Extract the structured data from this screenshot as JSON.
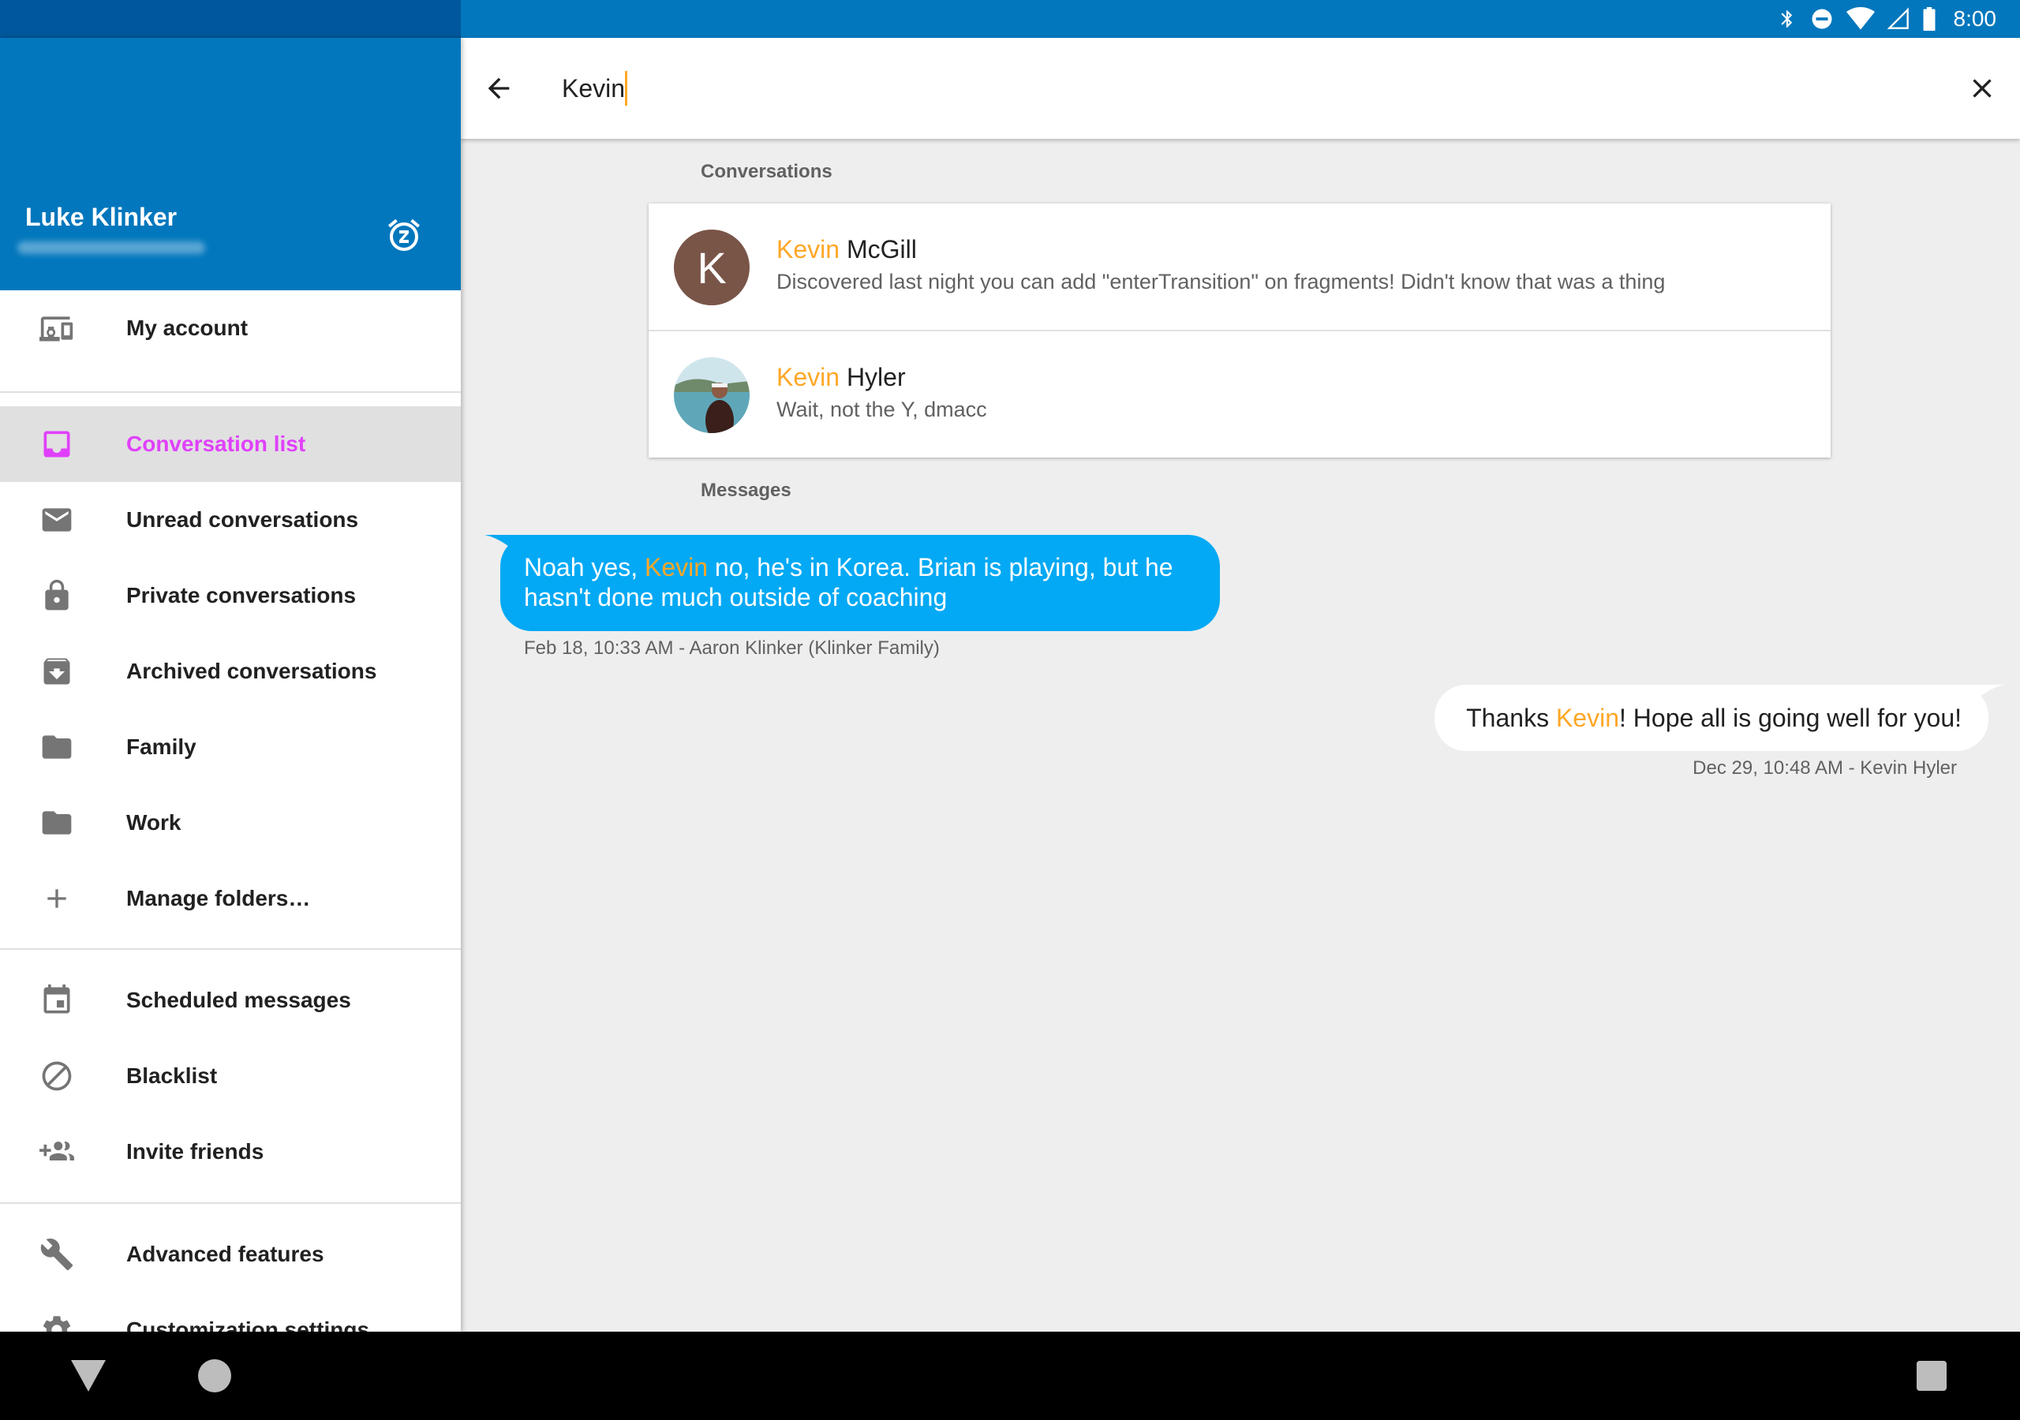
{
  "status_bar": {
    "time": "8:00",
    "icons": [
      "bluetooth-icon",
      "do-not-disturb-icon",
      "wifi-icon",
      "cell-signal-icon",
      "battery-icon"
    ]
  },
  "drawer": {
    "user_name": "Luke Klinker",
    "header_icon": "snooze-icon",
    "items": [
      {
        "label": "My account",
        "icon": "devices-icon"
      },
      {
        "label": "Conversation list",
        "icon": "inbox-icon",
        "selected": true
      },
      {
        "label": "Unread conversations",
        "icon": "mail-icon"
      },
      {
        "label": "Private conversations",
        "icon": "lock-icon"
      },
      {
        "label": "Archived conversations",
        "icon": "archive-icon"
      },
      {
        "label": "Family",
        "icon": "folder-icon"
      },
      {
        "label": "Work",
        "icon": "folder-icon"
      },
      {
        "label": "Manage folders…",
        "icon": "add-icon"
      },
      {
        "label": "Scheduled messages",
        "icon": "calendar-icon"
      },
      {
        "label": "Blacklist",
        "icon": "block-icon"
      },
      {
        "label": "Invite friends",
        "icon": "group-add-icon"
      },
      {
        "label": "Advanced features",
        "icon": "wrench-icon"
      },
      {
        "label": "Customization settings",
        "icon": "gear-icon"
      }
    ]
  },
  "search": {
    "query": "Kevin"
  },
  "results": {
    "conversations_header": "Conversations",
    "conversations": [
      {
        "highlight": "Kevin",
        "name_rest": " McGill",
        "snippet": "Discovered last night you can add \"enterTransition\" on fragments! Didn't know that was a thing",
        "avatar_letter": "K"
      },
      {
        "highlight": "Kevin",
        "name_rest": " Hyler",
        "snippet": "Wait, not the Y, dmacc"
      }
    ],
    "messages_header": "Messages",
    "messages": [
      {
        "before": "Noah yes, ",
        "highlight": "Kevin",
        "after": " no, he's in Korea. Brian is playing, but he hasn't done much outside of coaching",
        "meta": "Feb 18, 10:33 AM - Aaron Klinker (Klinker Family)"
      },
      {
        "before": "Thanks ",
        "highlight": "Kevin",
        "after": "! Hope all is going well for you!",
        "meta": "Dec 29, 10:48 AM - Kevin Hyler"
      }
    ]
  },
  "colors": {
    "primary": "#0277bd",
    "primary_dark": "#01579b",
    "accent": "#e040fb",
    "highlight": "#ffa726",
    "incoming_bubble": "#03a9f4"
  },
  "nav_bar": {
    "buttons": [
      "back-nav-icon",
      "home-nav-icon",
      "recents-nav-icon"
    ]
  }
}
